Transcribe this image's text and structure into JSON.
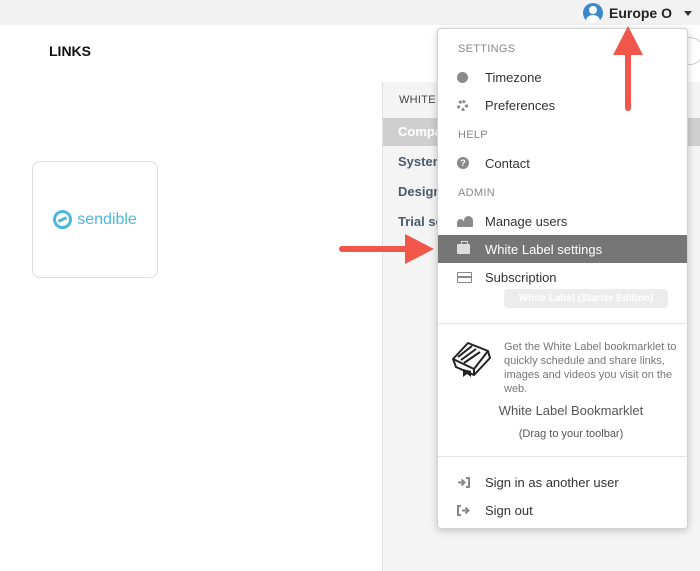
{
  "header": {
    "user_name": "Europe O"
  },
  "page": {
    "title": "LINKS"
  },
  "logo": {
    "text": "sendible",
    "color": "#4cb8de"
  },
  "side_panel": {
    "heading": "WHITE",
    "active_item": "Compa",
    "items": [
      "System",
      "Design",
      "Trial se"
    ]
  },
  "dropdown": {
    "settings_label": "SETTINGS",
    "timezone": "Timezone",
    "preferences": "Preferences",
    "help_label": "HELP",
    "contact": "Contact",
    "admin_label": "ADMIN",
    "manage_users": "Manage users",
    "white_label_settings": "White Label settings",
    "subscription": "Subscription",
    "edition_badge": "White Label (Starter Edition)",
    "bookmarklet_text": "Get the White Label bookmarklet to quickly schedule and share links, images and videos you visit on the web.",
    "bookmarklet_link": "White Label Bookmarklet",
    "bookmarklet_hint": "(Drag to your toolbar)",
    "sign_in_other": "Sign in as another user",
    "sign_out": "Sign out"
  },
  "annotations": {
    "arrow_color": "#f0574a"
  }
}
